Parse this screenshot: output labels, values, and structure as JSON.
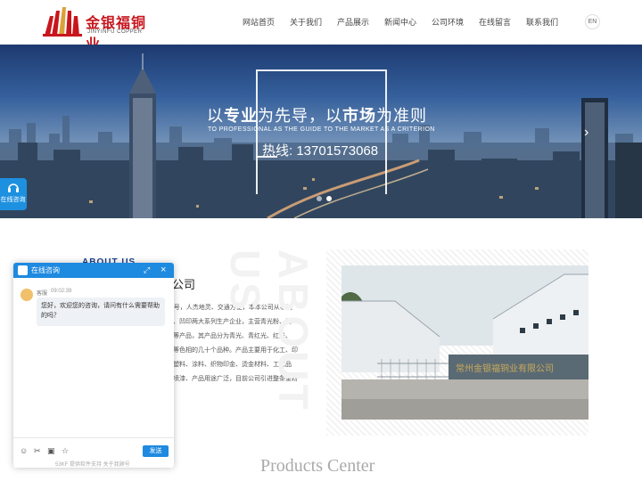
{
  "brand": {
    "name_cn": "金银福铜业",
    "name_en": "JINYINFU COPPER"
  },
  "nav": {
    "items": [
      "网站首页",
      "关于我们",
      "产品展示",
      "新闻中心",
      "公司环境",
      "在线留言",
      "联系我们"
    ],
    "lang": "EN"
  },
  "banner": {
    "slogan_part1": "以",
    "slogan_em1": "专业",
    "slogan_part2": "为先导，以",
    "slogan_em2": "市场",
    "slogan_part3": "为准则",
    "slogan_en": "TO PROFESSIONAL AS THE GUIDE TO THE MARKET AS A CRITERION",
    "hotline": "热线: 13701573068",
    "next_arrow": "›"
  },
  "side": {
    "label": "在线咨询"
  },
  "about": {
    "title_en": "ABOUT US",
    "company_tail": "限公司",
    "lines": [
      "路13号，人杰地灵、交通方便，本本公司从事铜",
      "胶印、凹印两大系列生产企业，主营青光粉、铜",
      "铜粉等产品，其产品分为青光、青红光、红光、",
      "金粉等色相的几十个品种。产品主要用于化工、印",
      "品、塑料、涂料、织物印金、烫金材料、工艺品",
      "、热喷漆、产品用途广泛，目前公司引进整条金粉"
    ]
  },
  "photo": {
    "gate_sign": "常州金银福铜业有限公司"
  },
  "products": {
    "title_en": "Products Center"
  },
  "chat": {
    "title": "在线咨询",
    "agent": "客服",
    "time": "09:02:39",
    "greeting": "您好，欢迎您的咨询，请问有什么需要帮助的吗？",
    "send_label": "发送",
    "footer": "53KF 提供软件支持  关于我顾号"
  }
}
